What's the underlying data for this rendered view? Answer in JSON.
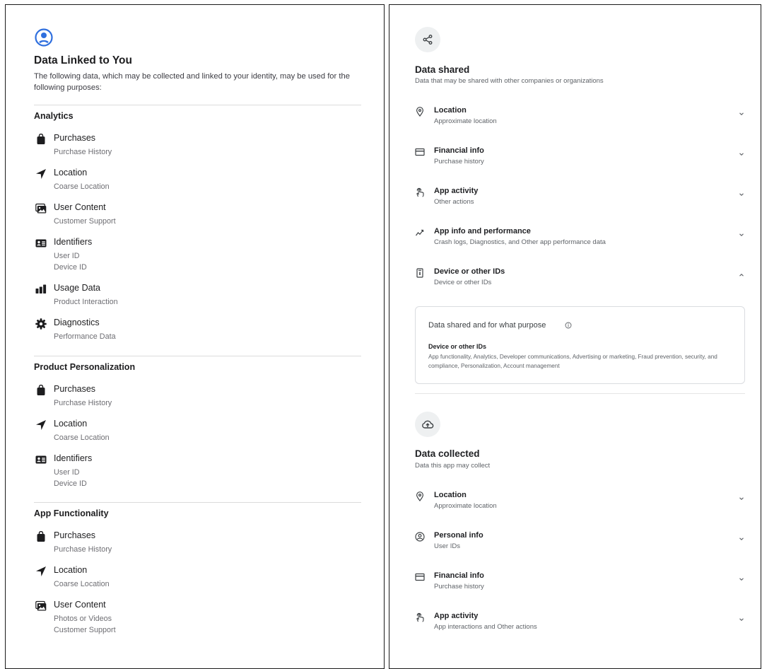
{
  "ios": {
    "title": "Data Linked to You",
    "description": "The following data, which may be collected and linked to your identity, may be used for the following purposes:",
    "sections": [
      {
        "title": "Analytics",
        "items": [
          {
            "icon": "bag-icon",
            "name": "Purchases",
            "sub": [
              "Purchase History"
            ]
          },
          {
            "icon": "location-arrow-icon",
            "name": "Location",
            "sub": [
              "Coarse Location"
            ]
          },
          {
            "icon": "photos-icon",
            "name": "User Content",
            "sub": [
              "Customer Support"
            ]
          },
          {
            "icon": "id-card-icon",
            "name": "Identifiers",
            "sub": [
              "User ID",
              "Device ID"
            ]
          },
          {
            "icon": "bar-chart-icon",
            "name": "Usage Data",
            "sub": [
              "Product Interaction"
            ]
          },
          {
            "icon": "gear-icon",
            "name": "Diagnostics",
            "sub": [
              "Performance Data"
            ]
          }
        ]
      },
      {
        "title": "Product Personalization",
        "items": [
          {
            "icon": "bag-icon",
            "name": "Purchases",
            "sub": [
              "Purchase History"
            ]
          },
          {
            "icon": "location-arrow-icon",
            "name": "Location",
            "sub": [
              "Coarse Location"
            ]
          },
          {
            "icon": "id-card-icon",
            "name": "Identifiers",
            "sub": [
              "User ID",
              "Device ID"
            ]
          }
        ]
      },
      {
        "title": "App Functionality",
        "items": [
          {
            "icon": "bag-icon",
            "name": "Purchases",
            "sub": [
              "Purchase History"
            ]
          },
          {
            "icon": "location-arrow-icon",
            "name": "Location",
            "sub": [
              "Coarse Location"
            ]
          },
          {
            "icon": "photos-icon",
            "name": "User Content",
            "sub": [
              "Photos or Videos",
              "Customer Support"
            ]
          }
        ]
      }
    ]
  },
  "play": {
    "shared": {
      "title": "Data shared",
      "description": "Data that may be shared with other companies or organizations",
      "rows": [
        {
          "icon": "location-pin-icon",
          "name": "Location",
          "sub": "Approximate location",
          "expanded": false
        },
        {
          "icon": "credit-card-icon",
          "name": "Financial info",
          "sub": "Purchase history",
          "expanded": false
        },
        {
          "icon": "touch-icon",
          "name": "App activity",
          "sub": "Other actions",
          "expanded": false
        },
        {
          "icon": "performance-icon",
          "name": "App info and performance",
          "sub": "Crash logs, Diagnostics, and Other app performance data",
          "expanded": false
        },
        {
          "icon": "device-icon",
          "name": "Device or other IDs",
          "sub": "Device or other IDs",
          "expanded": true
        }
      ],
      "detail": {
        "heading": "Data shared and for what purpose",
        "name": "Device or other IDs",
        "purposes": "App functionality, Analytics, Developer communications, Advertising or marketing, Fraud prevention, security, and compliance, Personalization, Account management"
      }
    },
    "collected": {
      "title": "Data collected",
      "description": "Data this app may collect",
      "rows": [
        {
          "icon": "location-pin-icon",
          "name": "Location",
          "sub": "Approximate location",
          "expanded": false
        },
        {
          "icon": "account-circle-icon",
          "name": "Personal info",
          "sub": "User IDs",
          "expanded": false
        },
        {
          "icon": "credit-card-icon",
          "name": "Financial info",
          "sub": "Purchase history",
          "expanded": false
        },
        {
          "icon": "touch-icon",
          "name": "App activity",
          "sub": "App interactions and Other actions",
          "expanded": false
        }
      ]
    }
  }
}
